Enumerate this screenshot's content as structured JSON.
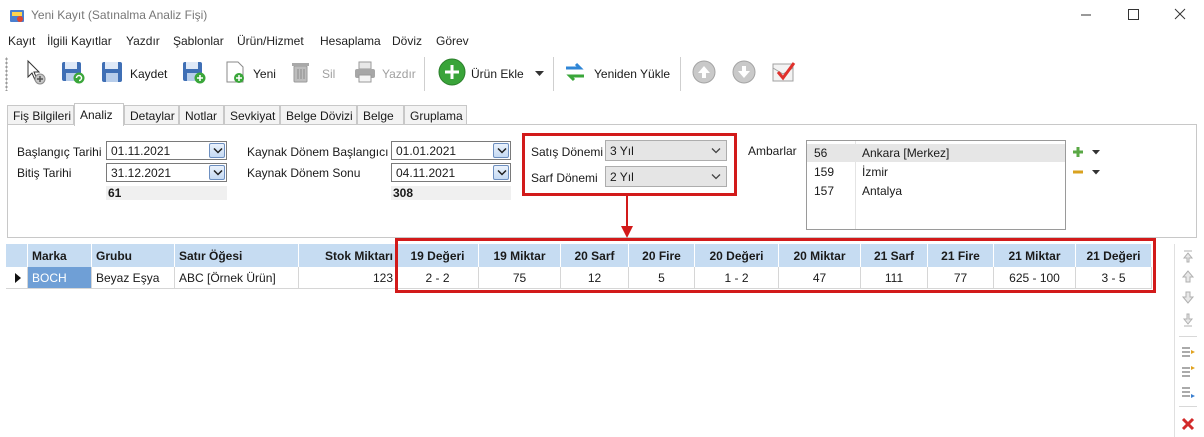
{
  "window": {
    "title": "Yeni Kayıt (Satınalma Analiz Fişi)"
  },
  "menu": [
    "Kayıt",
    "İlgili Kayıtlar",
    "Yazdır",
    "Şablonlar",
    "Ürün/Hizmet",
    "Hesaplama",
    "Döviz",
    "Görev"
  ],
  "toolbar": {
    "save_label": "Kaydet",
    "new_label": "Yeni",
    "delete_label": "Sil",
    "print_label": "Yazdır",
    "add_product_label": "Ürün Ekle",
    "reload_label": "Yeniden Yükle"
  },
  "tabs": [
    "Fiş Bilgileri",
    "Analiz",
    "Detaylar",
    "Notlar",
    "Sevkiyat",
    "Belge Dövizi",
    "Belge",
    "Gruplama"
  ],
  "active_tab": "Analiz",
  "filters": {
    "start_date_label": "Başlangıç Tarihi",
    "start_date": "01.11.2021",
    "end_date_label": "Bitiş Tarihi",
    "end_date": "31.12.2021",
    "day_count": "61",
    "source_start_label": "Kaynak Dönem Başlangıcı",
    "source_start": "01.01.2021",
    "source_end_label": "Kaynak Dönem Sonu",
    "source_end": "04.11.2021",
    "source_day_count": "308",
    "sales_period_label": "Satış Dönemi",
    "sales_period": "3 Yıl",
    "consumption_period_label": "Sarf Dönemi",
    "consumption_period": "2 Yıl"
  },
  "warehouses": {
    "label": "Ambarlar",
    "items": [
      {
        "code": "56",
        "name": "Ankara [Merkez]"
      },
      {
        "code": "159",
        "name": "İzmir"
      },
      {
        "code": "157",
        "name": "Antalya"
      }
    ]
  },
  "grid": {
    "columns": [
      "Marka",
      "Grubu",
      "Satır Öğesi",
      "Stok Miktarı",
      "19 Değeri",
      "19 Miktar",
      "20 Sarf",
      "20 Fire",
      "20 Değeri",
      "20 Miktar",
      "21 Sarf",
      "21 Fire",
      "21 Miktar",
      "21 Değeri"
    ],
    "rows": [
      [
        "BOCH",
        "Beyaz Eşya",
        "ABC [Örnek Ürün]",
        "123",
        "2 - 2",
        "75",
        "12",
        "5",
        "1 - 2",
        "47",
        "111",
        "77",
        "625 - 100",
        "3 - 5"
      ]
    ]
  },
  "colors": {
    "highlight_border": "#d21a1a",
    "grid_header": "#c6dcf2",
    "selected_cell": "#6f9fd6"
  }
}
